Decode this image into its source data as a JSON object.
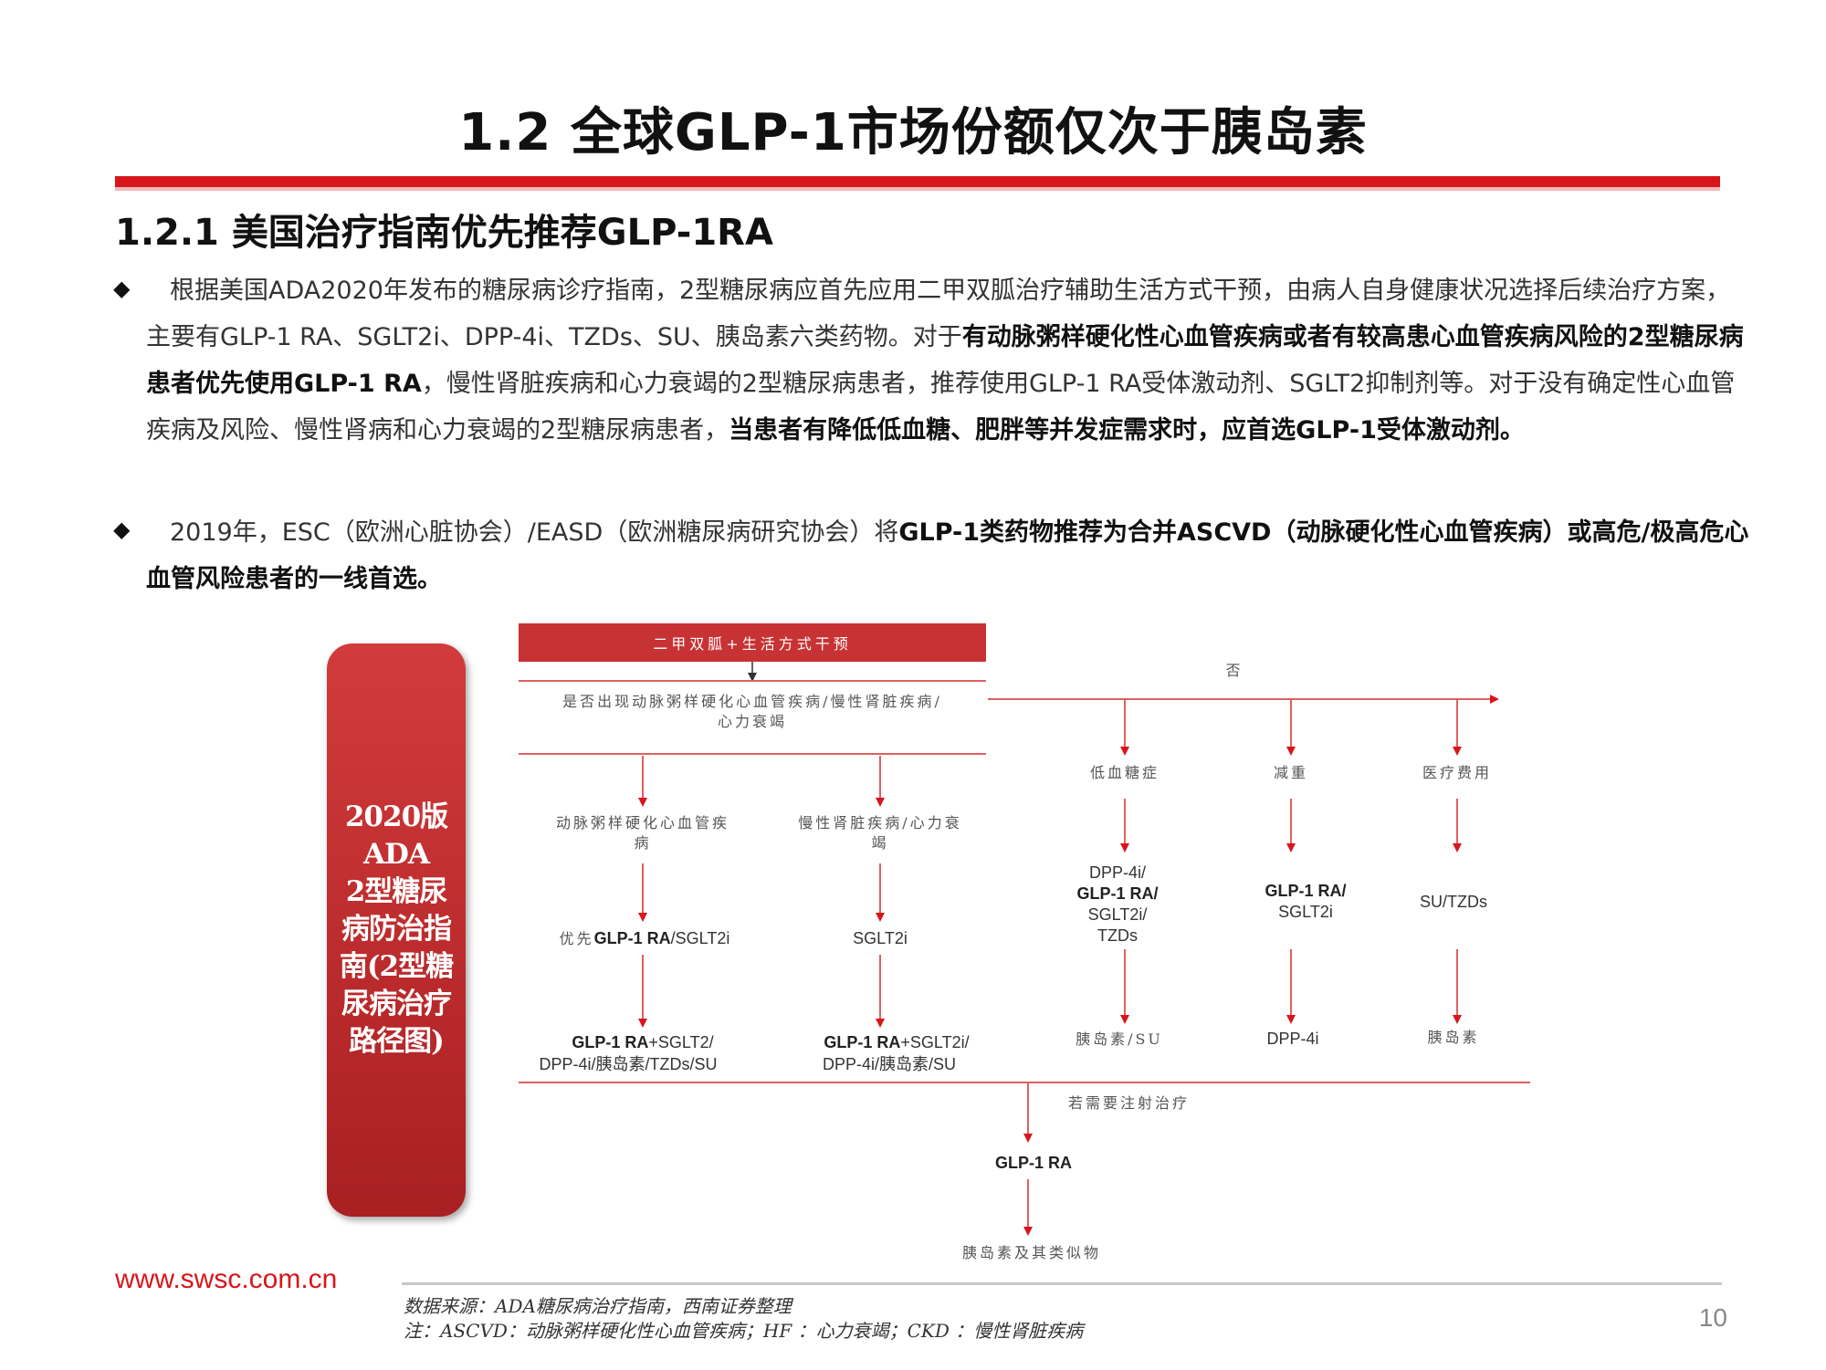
{
  "title": "1.2 全球GLP-1市场份额仅次于胰岛素",
  "section_heading": "1.2.1 美国治疗指南优先推荐GLP-1RA",
  "paragraphs": [
    {
      "p1": "根据美国ADA2020年发布的糖尿病诊疗指南，2型糖尿病应首先应用二甲双胍治疗辅助生活方式干预，由病人自身健康状况选择后续治疗方案，主要有GLP-1 RA、SGLT2i、DPP-4i、TZDs、SU、胰岛素六类药物。对于",
      "b1": "有动脉粥样硬化性心血管疾病或者有较高患心血管疾病风险的2型糖尿病患者优先使用GLP-1 RA",
      "p2": "，慢性肾脏疾病和心力衰竭的2型糖尿病患者，推荐使用GLP-1 RA受体激动剂、SGLT2抑制剂等。对于没有确定性心血管疾病及风险、慢性肾病和心力衰竭的2型糖尿病患者，",
      "b2": "当患者有降低低血糖、肥胖等并发症需求时，应首选GLP-1受体激动剂。"
    },
    {
      "p1": "2019年，ESC（欧洲心脏协会）/EASD（欧洲糖尿病研究协会）将",
      "b1": "GLP-1类药物推荐为合并ASCVD（动脉硬化性心血管疾病）或高危/极高危心血管风险患者的一线首选。"
    }
  ],
  "guide_label": [
    "2020版",
    "ADA",
    "2型糖尿",
    "病防治指",
    "南(2型糖",
    "尿病治疗",
    "路径图)"
  ],
  "flowchart": {
    "start": "二甲双胍+生活方式干预",
    "question": [
      "是否出现动脉粥样硬化心血管疾病/慢性肾脏疾病/",
      "心力衰竭"
    ],
    "no_label": "否",
    "branch_ascvd": [
      "动脉粥样硬化心血管疾",
      "病"
    ],
    "branch_ckd": [
      "慢性肾脏疾病/心力衰",
      "竭"
    ],
    "ascvd_step1_prefix": "优先",
    "ascvd_step1_bold": "GLP-1 RA",
    "ascvd_step1_rest": "/SGLT2i",
    "ckd_step1": "SGLT2i",
    "ascvd_step2_bold": "GLP-1 RA",
    "ascvd_step2_rest": "+SGLT2/",
    "ascvd_step2_line2": "DPP-4i/胰岛素/TZDs/SU",
    "ckd_step2_bold": "GLP-1 RA",
    "ckd_step2_rest": "+SGLT2i/",
    "ckd_step2_line2": "DPP-4i/胰岛素/SU",
    "hypo_label": "低血糖症",
    "weight_label": "减重",
    "cost_label": "医疗费用",
    "hypo_step1": [
      "DPP-4i/",
      "GLP-1 RA/",
      "SGLT2i/",
      "TZDs"
    ],
    "weight_step1": [
      "GLP-1 RA/",
      "SGLT2i"
    ],
    "cost_step1": "SU/TZDs",
    "hypo_step2": "胰岛素/SU",
    "weight_step2": "DPP-4i",
    "cost_step2": "胰岛素",
    "injection_label": "若需要注射治疗",
    "injection_step": "GLP-1 RA",
    "final_step": "胰岛素及其类似物"
  },
  "footer": {
    "url": "www.swsc.com.cn",
    "source": "数据来源：ADA糖尿病治疗指南，西南证券整理",
    "note": "注：ASCVD：动脉粥样硬化性心血管疾病；HF ：心力衰竭；CKD ：慢性肾脏疾病",
    "page": "10"
  },
  "colors": {
    "accent": "#d7161c",
    "pill": "#b52a2c",
    "line": "#e06060"
  }
}
